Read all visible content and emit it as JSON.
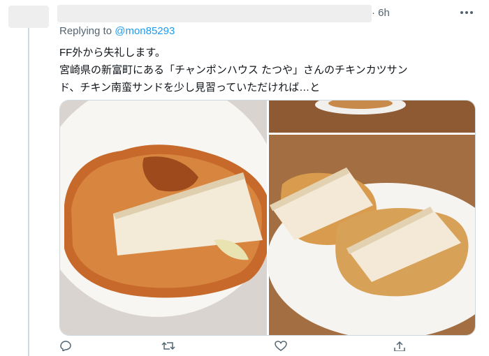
{
  "tweet": {
    "time": "6h",
    "reply_prefix": "Replying to",
    "reply_handle": "@mon85293",
    "text_lines": [
      "FF外から失礼します。",
      "宮崎県の新富町にある「チャンポンハウス たつや」さんのチキンカツサン",
      "ド、チキン南蛮サンドを少し見習っていただければ…と"
    ]
  },
  "icons": {
    "more": "more-icon",
    "reply": "reply-icon",
    "retweet": "retweet-icon",
    "like": "like-icon",
    "share": "share-icon"
  },
  "colors": {
    "accent": "#1d9bf0",
    "secondary_text": "#536471",
    "border": "#cfd9de"
  }
}
